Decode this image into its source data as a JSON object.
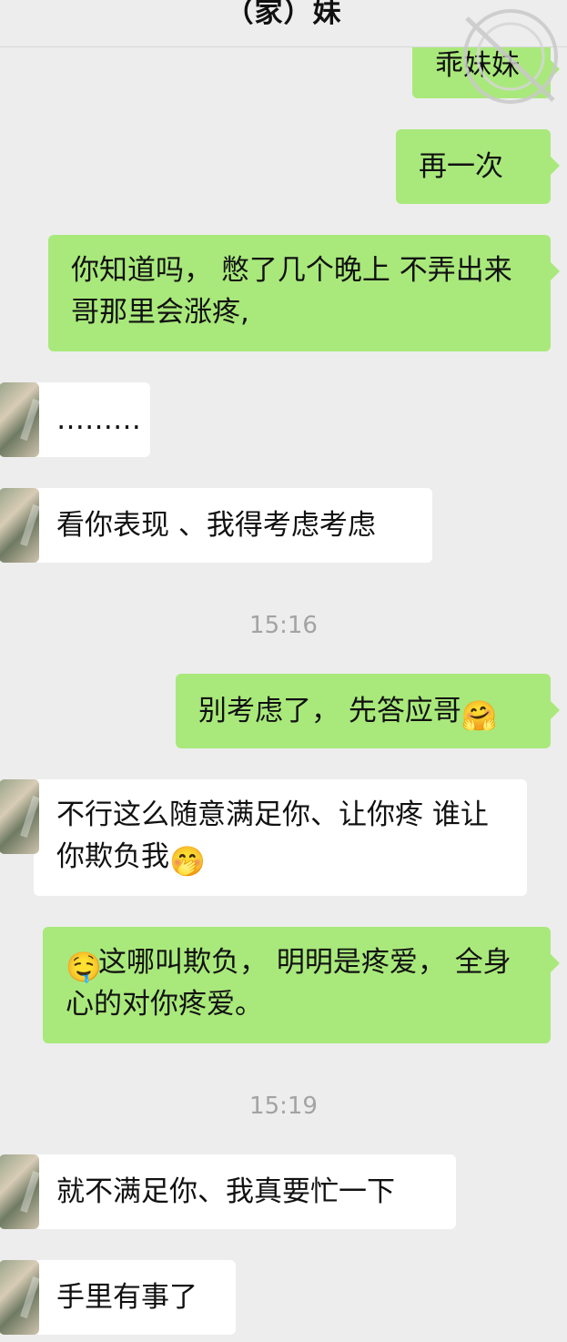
{
  "header": {
    "title": "（家）妹"
  },
  "messages": [
    {
      "side": "right",
      "text": "乖妹妹"
    },
    {
      "side": "right",
      "text": "再一次"
    },
    {
      "side": "right",
      "text": "你知道吗， 憋了几个晚上 不弄出来哥那里会涨疼,"
    },
    {
      "side": "left",
      "text": "………"
    },
    {
      "side": "left",
      "text": "看你表现 、我得考虑考虑"
    },
    {
      "side": "right",
      "text": "别考虑了， 先答应哥",
      "emoji": "🤗"
    },
    {
      "side": "left",
      "text": "不行这么随意满足你、让你疼 谁让你欺负我",
      "emoji": "🤭"
    },
    {
      "side": "right",
      "text": "这哪叫欺负， 明明是疼爱， 全身心的对你疼爱。",
      "emoji": "🤤"
    },
    {
      "side": "left",
      "text": "就不满足你、我真要忙一下"
    },
    {
      "side": "left",
      "text": "手里有事了"
    }
  ],
  "timestamps": [
    "15:16",
    "15:19"
  ]
}
